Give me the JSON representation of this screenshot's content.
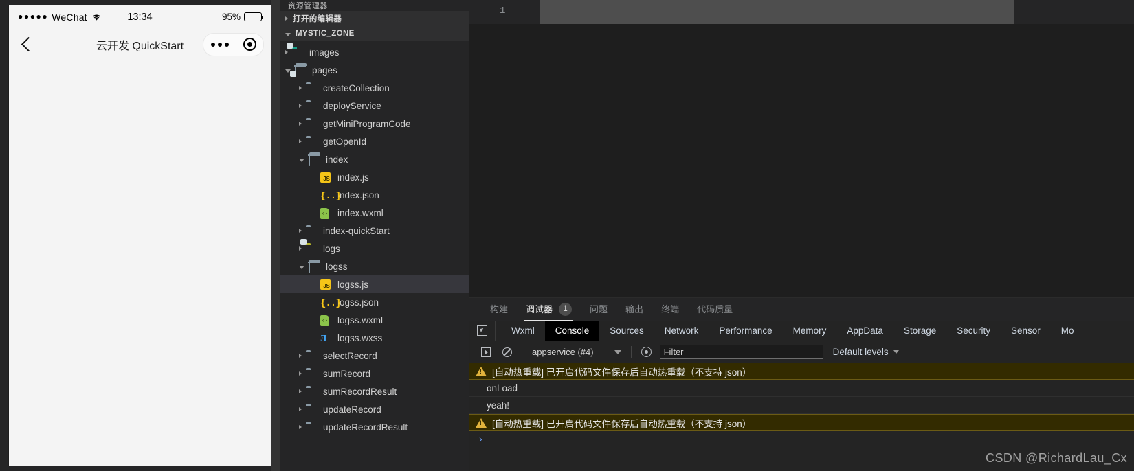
{
  "simulator": {
    "status_bar": {
      "signal_dots": "●●●●●",
      "carrier": "WeChat",
      "time": "13:34",
      "battery_percent": "95%"
    },
    "nav_bar": {
      "back_label": "‹",
      "title": "云开发 QuickStart"
    }
  },
  "explorer": {
    "clipped_title": "资源管理器",
    "open_editors_label": "打开的编辑器",
    "project_label": "MYSTIC_ZONE",
    "tree": [
      {
        "label": "images",
        "kind": "folder",
        "icon": "folder-images-icon",
        "depth": 1,
        "expanded": false,
        "selected": false
      },
      {
        "label": "pages",
        "kind": "folder-open",
        "icon": "folder-pages-icon",
        "depth": 1,
        "expanded": true,
        "selected": false
      },
      {
        "label": "createCollection",
        "kind": "folder",
        "icon": "folder-icon",
        "depth": 2,
        "expanded": false,
        "selected": false
      },
      {
        "label": "deployService",
        "kind": "folder",
        "icon": "folder-icon",
        "depth": 2,
        "expanded": false,
        "selected": false
      },
      {
        "label": "getMiniProgramCode",
        "kind": "folder",
        "icon": "folder-icon",
        "depth": 2,
        "expanded": false,
        "selected": false
      },
      {
        "label": "getOpenId",
        "kind": "folder",
        "icon": "folder-icon",
        "depth": 2,
        "expanded": false,
        "selected": false
      },
      {
        "label": "index",
        "kind": "folder-open",
        "icon": "folder-open-icon",
        "depth": 2,
        "expanded": true,
        "selected": false
      },
      {
        "label": "index.js",
        "kind": "file-js",
        "icon": "js-file-icon",
        "depth": 3,
        "expanded": null,
        "selected": false
      },
      {
        "label": "index.json",
        "kind": "file-json",
        "icon": "json-file-icon",
        "depth": 3,
        "expanded": null,
        "selected": false
      },
      {
        "label": "index.wxml",
        "kind": "file-wxml",
        "icon": "wxml-file-icon",
        "depth": 3,
        "expanded": null,
        "selected": false
      },
      {
        "label": "index-quickStart",
        "kind": "folder",
        "icon": "folder-icon",
        "depth": 2,
        "expanded": false,
        "selected": false
      },
      {
        "label": "logs",
        "kind": "folder",
        "icon": "folder-logs-icon",
        "depth": 2,
        "expanded": false,
        "selected": false
      },
      {
        "label": "logss",
        "kind": "folder-open",
        "icon": "folder-open-icon",
        "depth": 2,
        "expanded": true,
        "selected": false
      },
      {
        "label": "logss.js",
        "kind": "file-js",
        "icon": "js-file-icon",
        "depth": 3,
        "expanded": null,
        "selected": true
      },
      {
        "label": "logss.json",
        "kind": "file-json",
        "icon": "json-file-icon",
        "depth": 3,
        "expanded": null,
        "selected": false
      },
      {
        "label": "logss.wxml",
        "kind": "file-wxml",
        "icon": "wxml-file-icon",
        "depth": 3,
        "expanded": null,
        "selected": false
      },
      {
        "label": "logss.wxss",
        "kind": "file-wxss",
        "icon": "wxss-file-icon",
        "depth": 3,
        "expanded": null,
        "selected": false
      },
      {
        "label": "selectRecord",
        "kind": "folder",
        "icon": "folder-icon",
        "depth": 2,
        "expanded": false,
        "selected": false
      },
      {
        "label": "sumRecord",
        "kind": "folder",
        "icon": "folder-icon",
        "depth": 2,
        "expanded": false,
        "selected": false
      },
      {
        "label": "sumRecordResult",
        "kind": "folder",
        "icon": "folder-icon",
        "depth": 2,
        "expanded": false,
        "selected": false
      },
      {
        "label": "updateRecord",
        "kind": "folder",
        "icon": "folder-icon",
        "depth": 2,
        "expanded": false,
        "selected": false
      },
      {
        "label": "updateRecordResult",
        "kind": "folder",
        "icon": "folder-icon",
        "depth": 2,
        "expanded": false,
        "selected": false
      }
    ]
  },
  "editor": {
    "line_number": "1"
  },
  "panel": {
    "tabs": [
      {
        "label": "构建",
        "badge": null,
        "active": false
      },
      {
        "label": "调试器",
        "badge": "1",
        "active": true
      },
      {
        "label": "问题",
        "badge": null,
        "active": false
      },
      {
        "label": "输出",
        "badge": null,
        "active": false
      },
      {
        "label": "终端",
        "badge": null,
        "active": false
      },
      {
        "label": "代码质量",
        "badge": null,
        "active": false
      }
    ]
  },
  "devtools": {
    "tabs": [
      {
        "label": "Wxml",
        "active": false
      },
      {
        "label": "Console",
        "active": true
      },
      {
        "label": "Sources",
        "active": false
      },
      {
        "label": "Network",
        "active": false
      },
      {
        "label": "Performance",
        "active": false
      },
      {
        "label": "Memory",
        "active": false
      },
      {
        "label": "AppData",
        "active": false
      },
      {
        "label": "Storage",
        "active": false
      },
      {
        "label": "Security",
        "active": false
      },
      {
        "label": "Sensor",
        "active": false
      },
      {
        "label": "Mo",
        "active": false
      }
    ],
    "toolbar": {
      "context_value": "appservice (#4)",
      "filter_placeholder": "Filter",
      "filter_value": "",
      "levels_label": "Default levels"
    },
    "console_logs": [
      {
        "type": "warning",
        "text": "[自动热重载] 已开启代码文件保存后自动热重载（不支持 json）"
      },
      {
        "type": "log",
        "text": "onLoad"
      },
      {
        "type": "log",
        "text": "yeah!"
      },
      {
        "type": "warning",
        "text": "[自动热重载] 已开启代码文件保存后自动热重载（不支持 json）"
      }
    ],
    "prompt_symbol": "›"
  },
  "watermark": "CSDN @RichardLau_Cx",
  "colors": {
    "editor_bg": "#1e1e1e",
    "sidebar_bg": "#252526",
    "selection": "#37373d",
    "warning_bg": "#332b00",
    "warning_accent": "#e2b33c",
    "active_tab": "#000000"
  }
}
